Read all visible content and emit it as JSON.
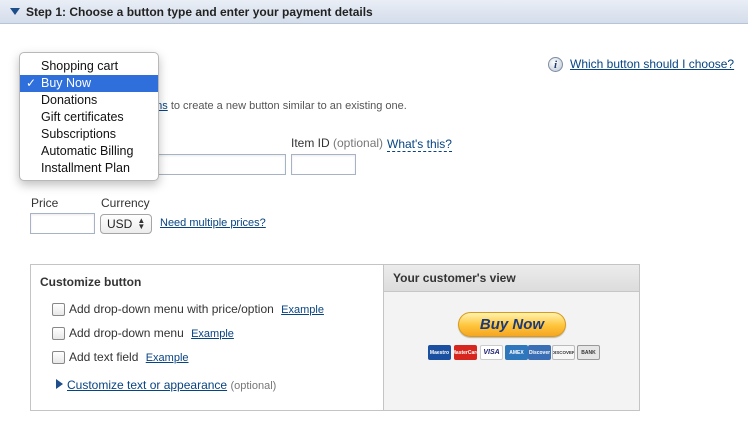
{
  "step": {
    "title": "Step 1: Choose a button type and enter your payment details"
  },
  "help": {
    "link": "Which button should I choose?"
  },
  "button_type": {
    "options": [
      "Shopping cart",
      "Buy Now",
      "Donations",
      "Gift certificates",
      "Subscriptions",
      "Automatic Billing",
      "Installment Plan"
    ],
    "selected": "Buy Now",
    "check_mark": "✓"
  },
  "hint": {
    "link_fragment": "ons",
    "text": "to create a new button similar to an existing one."
  },
  "item_id": {
    "label": "Item ID",
    "optional": "(optional)",
    "help_link": "What's this?"
  },
  "price": {
    "label": "Price"
  },
  "currency": {
    "label": "Currency",
    "value": "USD",
    "multiple_link": "Need multiple prices?"
  },
  "customize": {
    "title": "Customize button",
    "options": [
      {
        "label": "Add drop-down menu with price/option",
        "example": "Example"
      },
      {
        "label": "Add drop-down menu",
        "example": "Example"
      },
      {
        "label": "Add text field",
        "example": "Example"
      }
    ],
    "appearance_link": "Customize text or appearance",
    "appearance_optional": "(optional)"
  },
  "preview": {
    "title": "Your customer's view",
    "button_label": "Buy Now",
    "cards": [
      "Maestro",
      "MasterCard",
      "VISA",
      "AMEX",
      "Discover",
      "DISCOVER",
      "BANK"
    ]
  }
}
